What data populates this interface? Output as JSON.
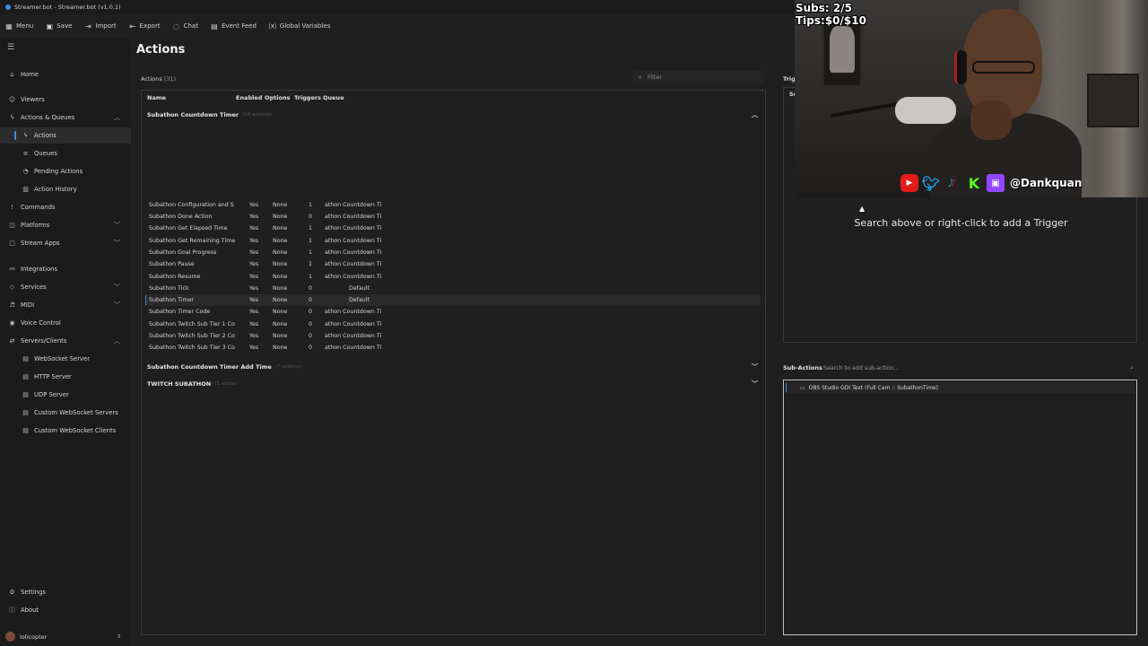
{
  "window": {
    "title": "Streamer.bot - Streamer.bot (v1.0.1)"
  },
  "toolbar": [
    {
      "label": "Menu",
      "icon": "grid-icon"
    },
    {
      "label": "Save",
      "icon": "save-icon"
    },
    {
      "label": "Import",
      "icon": "import-icon"
    },
    {
      "label": "Export",
      "icon": "export-icon"
    },
    {
      "label": "Chat",
      "icon": "chat-icon"
    },
    {
      "label": "Event Feed",
      "icon": "feed-icon"
    },
    {
      "label": "Global Variables",
      "icon": "variables-icon"
    }
  ],
  "sidebar": {
    "items": [
      {
        "label": "Home"
      },
      {
        "label": "Viewers"
      },
      {
        "label": "Actions & Queues"
      },
      {
        "label": "Actions"
      },
      {
        "label": "Queues"
      },
      {
        "label": "Pending Actions"
      },
      {
        "label": "Action History"
      },
      {
        "label": "Commands"
      },
      {
        "label": "Platforms"
      },
      {
        "label": "Stream Apps"
      },
      {
        "label": "Integrations"
      },
      {
        "label": "Services"
      },
      {
        "label": "MIDI"
      },
      {
        "label": "Voice Control"
      },
      {
        "label": "Servers/Clients"
      },
      {
        "label": "WebSocket Server"
      },
      {
        "label": "HTTP Server"
      },
      {
        "label": "UDP Server"
      },
      {
        "label": "Custom WebSocket Servers"
      },
      {
        "label": "Custom WebSocket Clients"
      }
    ],
    "settings": "Settings",
    "about": "About",
    "user": "lolicopter"
  },
  "main": {
    "title": "Actions",
    "actions_label": "Actions",
    "actions_count": "(31)",
    "filter_placeholder": "Filter",
    "columns": {
      "name": "Name",
      "enabled": "Enabled",
      "options": "Options",
      "triggers": "Triggers",
      "queue": "Queue"
    },
    "groups": [
      {
        "name": "Subathon Countdown Timer",
        "count": "(14 actions)"
      },
      {
        "name": "Subathon Countdown Timer Add Time",
        "count": "(7 actions)"
      },
      {
        "name": "TWITCH SUBATHON",
        "count": "(1 action)"
      }
    ],
    "rows": [
      {
        "name": "Subathon Configuration and S",
        "enabled": "Yes",
        "options": "None",
        "triggers": "1",
        "queue": "athon Countdown Ti"
      },
      {
        "name": "Subathon Done Action",
        "enabled": "Yes",
        "options": "None",
        "triggers": "0",
        "queue": "athon Countdown Ti"
      },
      {
        "name": "Subathon Get Elapsed Time",
        "enabled": "Yes",
        "options": "None",
        "triggers": "1",
        "queue": "athon Countdown Ti"
      },
      {
        "name": "Subathon Get Remaining Time",
        "enabled": "Yes",
        "options": "None",
        "triggers": "1",
        "queue": "athon Countdown Ti"
      },
      {
        "name": "Subathon Goal Progress",
        "enabled": "Yes",
        "options": "None",
        "triggers": "1",
        "queue": "athon Countdown Ti"
      },
      {
        "name": "Subathon Pause",
        "enabled": "Yes",
        "options": "None",
        "triggers": "1",
        "queue": "athon Countdown Ti"
      },
      {
        "name": "Subathon Resume",
        "enabled": "Yes",
        "options": "None",
        "triggers": "1",
        "queue": "athon Countdown Ti"
      },
      {
        "name": "Subathon Tick",
        "enabled": "Yes",
        "options": "None",
        "triggers": "0",
        "queue": "Default"
      },
      {
        "name": "Subathon Timer",
        "enabled": "Yes",
        "options": "None",
        "triggers": "0",
        "queue": "Default"
      },
      {
        "name": "Subathon Timer Code",
        "enabled": "Yes",
        "options": "None",
        "triggers": "0",
        "queue": "athon Countdown Ti"
      },
      {
        "name": "Subathon Twitch Sub Tier 1 Co",
        "enabled": "Yes",
        "options": "None",
        "triggers": "0",
        "queue": "athon Countdown Ti"
      },
      {
        "name": "Subathon Twitch Sub Tier 2 Co",
        "enabled": "Yes",
        "options": "None",
        "triggers": "0",
        "queue": "athon Countdown Ti"
      },
      {
        "name": "Subathon Twitch Sub Tier 3 Co",
        "enabled": "Yes",
        "options": "None",
        "triggers": "0",
        "queue": "athon Countdown Ti"
      }
    ],
    "selected_row": 8
  },
  "triggers": {
    "label": "Trig",
    "column": "So",
    "hint": "Search above or right-click to add a Trigger"
  },
  "subactions": {
    "label": "Sub-Actions",
    "search_placeholder": "Search to add sub-action...",
    "items": [
      {
        "label": "OBS Studio GDI Text (Full Cam :: SubathonTime)"
      }
    ]
  },
  "webcam": {
    "overlay_line1": "Subs: 2/5",
    "overlay_line2": "Tips:$0/$10",
    "handle": "@Dankquan"
  }
}
